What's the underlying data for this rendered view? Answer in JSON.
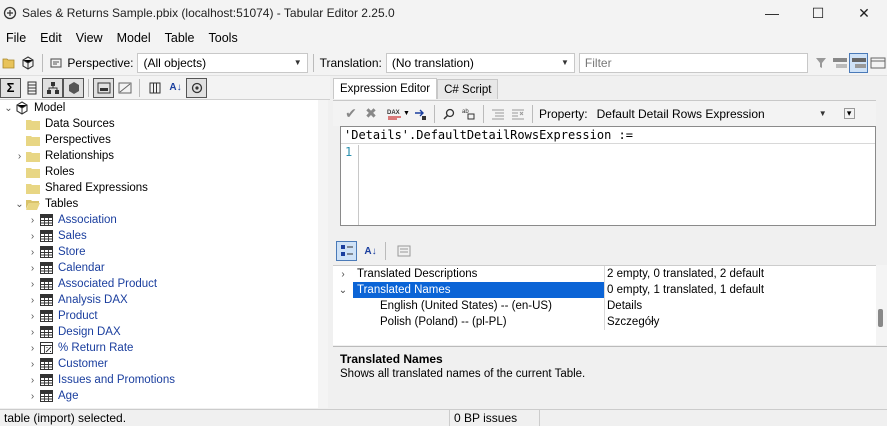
{
  "window": {
    "title": "Sales & Returns Sample.pbix (localhost:51074) - Tabular Editor 2.25.0",
    "minimize": "—",
    "maximize": "☐",
    "close": "✕"
  },
  "menu": [
    "File",
    "Edit",
    "View",
    "Model",
    "Table",
    "Tools"
  ],
  "toolbar": {
    "perspective_label": "Perspective:",
    "perspective_value": "(All objects)",
    "translation_label": "Translation:",
    "translation_value": "(No translation)",
    "filter_placeholder": "Filter"
  },
  "tree": {
    "model": "Model",
    "folders": [
      "Data Sources",
      "Perspectives",
      "Relationships",
      "Roles",
      "Shared Expressions"
    ],
    "tables_label": "Tables",
    "tables": [
      "Association",
      "Sales",
      "Store",
      "Calendar",
      "Associated Product",
      "Analysis DAX",
      "Product",
      "Design DAX",
      "% Return Rate",
      "Customer",
      "Issues and Promotions",
      "Age"
    ]
  },
  "tabs": [
    "Expression Editor",
    "C# Script"
  ],
  "expression_toolbar": {
    "property_label": "Property:",
    "property_value": "Default Detail Rows Expression"
  },
  "editor": {
    "expression": "'Details'.DefaultDetailRowsExpression :=",
    "line_numbers": [
      "1"
    ]
  },
  "properties": {
    "rows": [
      {
        "name": "Translated Descriptions",
        "value": "2 empty, 0 translated, 2 default",
        "expander": "›"
      },
      {
        "name": "Translated Names",
        "value": "0 empty, 1 translated, 1 default",
        "expander": "⌄"
      },
      {
        "name": "English (United States) -- (en-US)",
        "value": "Details",
        "expander": ""
      },
      {
        "name": "Polish (Poland) -- (pl-PL)",
        "value": "Szczegóły",
        "expander": ""
      }
    ]
  },
  "description": {
    "title": "Translated Names",
    "text": "Shows all translated names of the current Table."
  },
  "status": {
    "left": "table (import) selected.",
    "bp_issues": "0 BP issues"
  },
  "colors": {
    "selection": "#0b64d6",
    "table_link": "#1a3e9e",
    "folder": "#e8d684",
    "line_number": "#2b91af"
  }
}
